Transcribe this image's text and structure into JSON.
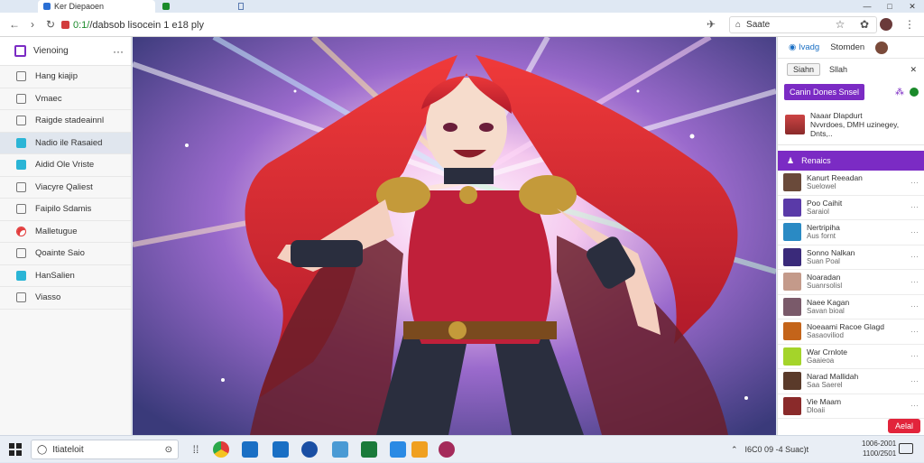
{
  "browser": {
    "tabs": [
      {
        "label": "Ker Diepaoen",
        "active": true
      },
      {
        "label": "",
        "active": false
      }
    ],
    "url_scheme": "0:1/",
    "url_rest": "/dabsob lisocein 1 e18 ply",
    "search_text": "Saate",
    "window_controls": [
      "—",
      "□",
      "✕"
    ]
  },
  "left_panel": {
    "header": "Vienoing",
    "items": [
      {
        "label": "Hang kiajip",
        "icon": "square",
        "selected": false
      },
      {
        "label": "Vmaec",
        "icon": "square",
        "selected": false
      },
      {
        "label": "Raigde stadeainnl",
        "icon": "square",
        "selected": false
      },
      {
        "label": "Nadio ile Rasaied",
        "icon": "teal",
        "selected": true
      },
      {
        "label": "Aidid Ole Vriste",
        "icon": "teal",
        "selected": false
      },
      {
        "label": "Viacyre Qaliest",
        "icon": "square",
        "selected": false
      },
      {
        "label": "Faipilo Sdamis",
        "icon": "square",
        "selected": false
      },
      {
        "label": "Malletugue",
        "icon": "red",
        "selected": false
      },
      {
        "label": "Qoainte Saio",
        "icon": "square",
        "selected": false
      },
      {
        "label": "HanSalien",
        "icon": "teal",
        "selected": false
      },
      {
        "label": "Viasso",
        "icon": "square",
        "selected": false
      }
    ]
  },
  "right_panel": {
    "tabs": [
      "Ivadg",
      "Stomden"
    ],
    "filter_chip": "Siahn",
    "filter_label": "Sllah",
    "purple_button": "Canin Dones Snsel",
    "post": {
      "line1": "Naaar Dlapdurt",
      "line2": "Nvvrdoes, DMH uzinegey,",
      "line3": "Dnts,.."
    },
    "section_title": "Renaics",
    "rows": [
      {
        "name": "Kanurt Reeadan",
        "sub": "Suelowel",
        "color": "#6a4a3a"
      },
      {
        "name": "Poo Caihit",
        "sub": "Saraiol",
        "color": "#5a3aa8"
      },
      {
        "name": "Nertripiha",
        "sub": "Aus fornt",
        "color": "#2a8ac4"
      },
      {
        "name": "Sonno Nalkan",
        "sub": "Suan Poal",
        "color": "#3a2a7a"
      },
      {
        "name": "Noaradan",
        "sub": "Suanrsolisl",
        "color": "#c49a8a"
      },
      {
        "name": "Naee Kagan",
        "sub": "Savan bioal",
        "color": "#7a5a6a"
      },
      {
        "name": "Noeaami Racoe Glagd",
        "sub": "Sasaoviliod",
        "color": "#c4641a"
      },
      {
        "name": "War Crnlote",
        "sub": "Gaaieoa",
        "color": "#a4d42a"
      },
      {
        "name": "Narad Mallidah",
        "sub": "Saa Saerel",
        "color": "#5a3a2a"
      },
      {
        "name": "Vie Maam",
        "sub": "Dloaii",
        "color": "#8a2a2a"
      }
    ],
    "red_button": "Aelal"
  },
  "taskbar": {
    "search_text": "Itiateloit",
    "clock_line1": "1006-2001",
    "clock_line2": "1100/2501"
  },
  "tray_text": "I6C0 09 -4 Suac)t",
  "colors": {
    "accent": "#7b2bc4",
    "red": "#e2243b",
    "teal": "#2bb5d6"
  }
}
